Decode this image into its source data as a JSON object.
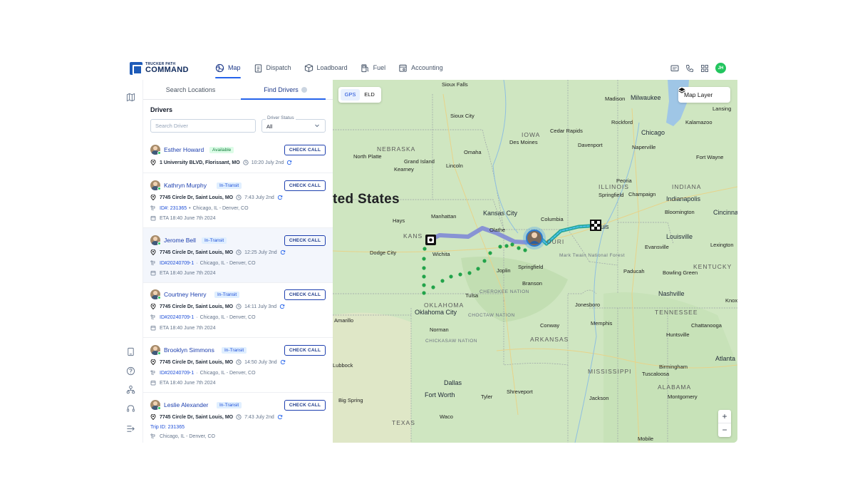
{
  "brand": {
    "small": "TRUCKER PATH",
    "big": "COMMAND"
  },
  "nav": [
    {
      "label": "Map",
      "icon": "globe-icon",
      "active": true
    },
    {
      "label": "Dispatch",
      "icon": "clipboard-icon"
    },
    {
      "label": "Loadboard",
      "icon": "box-icon"
    },
    {
      "label": "Fuel",
      "icon": "fuel-pump-icon"
    },
    {
      "label": "Accounting",
      "icon": "ledger-icon"
    }
  ],
  "user": {
    "initials": "JH"
  },
  "panel": {
    "tabs": {
      "search_locations": "Search Locations",
      "find_drivers": "Find Drivers"
    },
    "drivers_title": "Drivers",
    "search_placeholder": "Search Driver",
    "status_label": "Driver Status",
    "status_value": "All",
    "check_call_label": "CHECK CALL"
  },
  "drivers": [
    {
      "name": "Esther Howard",
      "status": "Available",
      "address": "1 University BLVD, Florissant, MO",
      "time": "10:20 July 2nd"
    },
    {
      "name": "Kathryn Murphy",
      "status": "In-Transit",
      "address": "7745 Circle Dr, Saint Louis, MO",
      "time": "7:43 July 2nd",
      "trip_id": "ID#: 231365",
      "route": "Chicago, IL - Denver, CO",
      "eta": "ETA 18:40 June 7th 2024"
    },
    {
      "name": "Jerome Bell",
      "status": "In-Transit",
      "address": "7745 Circle Dr, Saint Louis, MO",
      "time": "12:25 July 2nd",
      "trip_id": "ID#20240709-1",
      "route": "Chicago, IL - Denver, CO",
      "eta": "ETA 18:40 June 7th 2024"
    },
    {
      "name": "Courtney Henry",
      "status": "In-Transit",
      "address": "7745 Circle Dr, Saint Louis, MO",
      "time": "14:11 July 3nd",
      "trip_id": "ID#20240709-1",
      "route": "Chicago, IL - Denver, CO",
      "eta": "ETA 18:40 June 7th 2024"
    },
    {
      "name": "Brooklyn Simmons",
      "status": "In-Transit",
      "address": "7745 Circle Dr, Saint Louis, MO",
      "time": "14:50 July 3nd",
      "trip_id": "ID#20240709-1",
      "route": "Chicago, IL - Denver, CO",
      "eta": "ETA 18:40 June 7th 2024"
    },
    {
      "name": "Leslie Alexander",
      "status": "In-Transit",
      "address": "7745 Circle Dr, Saint Louis, MO",
      "time": "7:43 July 2nd",
      "trip_id": "Trip ID: 231365",
      "route": "Chicago, IL - Denver, CO"
    }
  ],
  "map": {
    "gps": "GPS",
    "eld": "ELD",
    "layer_button": "Map Layer",
    "zoom_in": "+",
    "zoom_out": "−",
    "labels": {
      "country": "ted States",
      "states": [
        "NEBRASKA",
        "IOWA",
        "ILLINOIS",
        "INDIANA",
        "KANS",
        "OURI",
        "KENTUCKY",
        "OKLAHOMA",
        "ARKANSAS",
        "TENNESSEE",
        "MISSISSIPPI",
        "ALABAMA",
        "TEXAS"
      ],
      "areas": [
        "CHEROKEE NATION",
        "CHOCTAW NATION",
        "CHICKASAW NATION",
        "Mark Twain National Forest"
      ],
      "cities": [
        "Sioux Falls",
        "Madison",
        "Milwaukee",
        "Lansing",
        "Sioux City",
        "Rockford",
        "Chicago",
        "Kalamazoo",
        "Cedar Rapids",
        "Des Moines",
        "Davenport",
        "Naperville",
        "Fort Wayne",
        "North Platte",
        "Omaha",
        "Grand Island",
        "Lincoln",
        "Kearney",
        "Peoria",
        "Springfield",
        "Champaign",
        "Indianapolis",
        "Bloomington",
        "Cincinnat",
        "Hays",
        "Manhattan",
        "Kansas City",
        "Columbia",
        "Olathe",
        "uis",
        "Louisville",
        "Lexington",
        "Dodge City",
        "Wichita",
        "Evansville",
        "Joplin",
        "Springfield",
        "Bowling Green",
        "Paducah",
        "Branson",
        "Tulsa",
        "Nashville",
        "Knox",
        "Oklahoma City",
        "Jonesboro",
        "Amarillo",
        "Norman",
        "Memphis",
        "Chattanooga",
        "Conway",
        "Huntsville",
        "Lubbock",
        "Atlanta",
        "Birmingham",
        "Tuscaloosa",
        "Dallas",
        "Shreveport",
        "Montgomery",
        "Fort Worth",
        "Tyler",
        "Jackson",
        "Big Spring",
        "Waco",
        "Mobile"
      ]
    }
  }
}
